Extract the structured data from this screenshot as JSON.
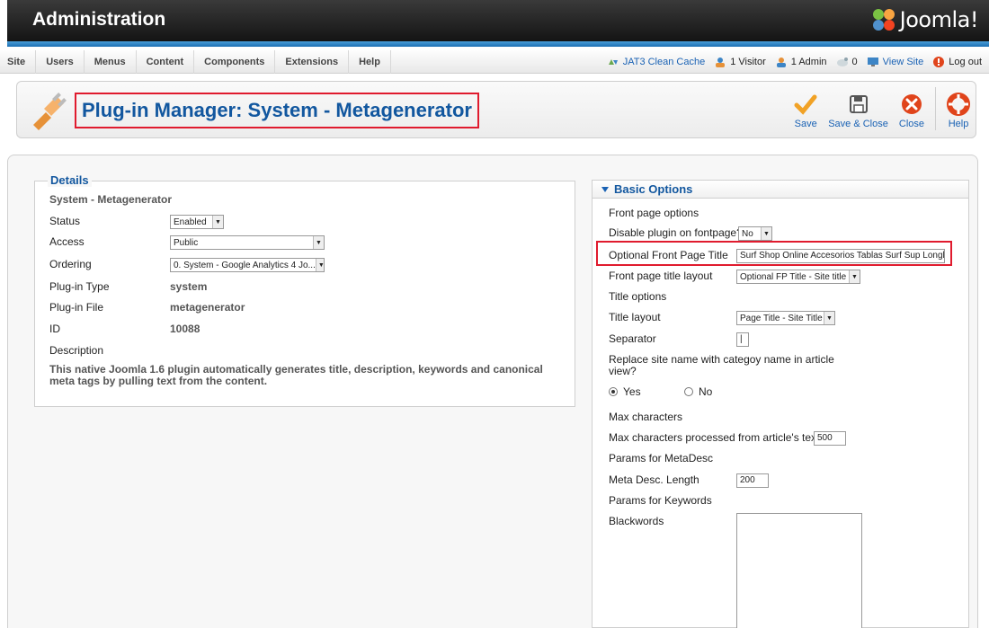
{
  "header": {
    "title": "Administration",
    "logo_text": "Joomla!"
  },
  "menu": {
    "items": [
      "Site",
      "Users",
      "Menus",
      "Content",
      "Components",
      "Extensions",
      "Help"
    ],
    "right": {
      "clean_cache": "JAT3 Clean Cache",
      "visitors": "1 Visitor",
      "admins": "1 Admin",
      "messages": "0",
      "view_site": "View Site",
      "logout": "Log out"
    }
  },
  "toolbar": {
    "page_title": "Plug-in Manager: System - Metagenerator",
    "save": "Save",
    "save_close": "Save & Close",
    "close": "Close",
    "help": "Help"
  },
  "details": {
    "legend": "Details",
    "plugin_name": "System - Metagenerator",
    "status_label": "Status",
    "status_value": "Enabled",
    "access_label": "Access",
    "access_value": "Public",
    "ordering_label": "Ordering",
    "ordering_value": "0. System - Google Analytics 4 Jo...",
    "type_label": "Plug-in Type",
    "type_value": "system",
    "file_label": "Plug-in File",
    "file_value": "metagenerator",
    "id_label": "ID",
    "id_value": "10088",
    "description_label": "Description",
    "description": "This native Joomla 1.6 plugin automatically generates title, description, keywords and canonical meta tags by pulling text from the content."
  },
  "options": {
    "title": "Basic Options",
    "front_page_options": "Front page options",
    "disable_label": "Disable plugin on fontpage?",
    "disable_value": "No",
    "fp_title_label": "Optional Front Page Title",
    "fp_title_value": "Surf Shop Online Accesorios Tablas Surf Sup Longbo",
    "fp_layout_label": "Front page title layout",
    "fp_layout_value": "Optional FP Title - Site title",
    "title_options": "Title options",
    "title_layout_label": "Title layout",
    "title_layout_value": "Page Title - Site Title",
    "separator_label": "Separator",
    "separator_value": "|",
    "replace_label_1": "Replace site name with categoy name in article",
    "replace_label_2": "view?",
    "yes": "Yes",
    "no": "No",
    "max_chars": "Max characters",
    "max_processed_label": "Max characters processed from article's text.",
    "max_processed_value": "500",
    "params_metadesc": "Params for MetaDesc",
    "metadesc_length_label": "Meta Desc. Length",
    "metadesc_length_value": "200",
    "params_keywords": "Params for Keywords",
    "blackwords_label": "Blackwords",
    "blackwords_value": ""
  }
}
